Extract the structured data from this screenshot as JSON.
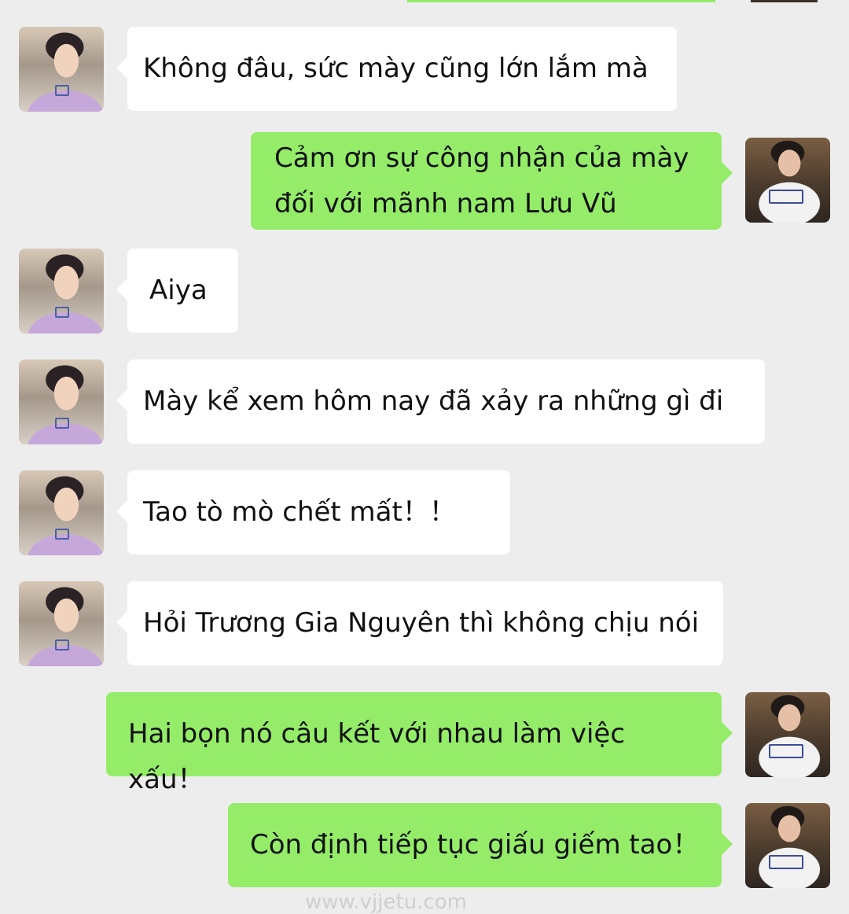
{
  "conversation": {
    "messages": [
      {
        "side": "left",
        "text": "Không đâu, sức mày cũng lớn lắm mà"
      },
      {
        "side": "right",
        "lines": [
          "Cảm ơn sự công nhận của mày",
          "đối với mãnh nam Lưu Vũ"
        ]
      },
      {
        "side": "left",
        "text": "Aiya"
      },
      {
        "side": "left",
        "text": "Mày kể xem hôm nay đã xảy ra những gì đi"
      },
      {
        "side": "left",
        "text": "Tao tò mò chết mất！！"
      },
      {
        "side": "left",
        "text": "Hỏi Trương Gia Nguyên thì không chịu nói"
      },
      {
        "side": "right",
        "text": "Hai bọn nó câu kết với nhau làm việc xấu！"
      },
      {
        "side": "right",
        "text": "Còn định tiếp tục giấu giếm tao！"
      }
    ]
  },
  "watermark": "www.vjjetu.com",
  "colors": {
    "background": "#ededed",
    "incoming_bubble": "#ffffff",
    "outgoing_bubble": "#95ec69"
  },
  "icons": {
    "incoming_avatar": "avatar-purple-hoodie",
    "outgoing_avatar": "avatar-mirror-selfie"
  }
}
